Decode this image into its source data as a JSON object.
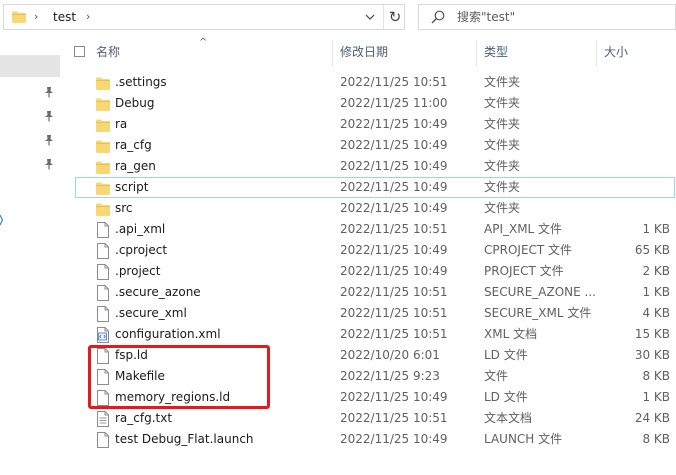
{
  "address_bar": {
    "path_segment": "test",
    "dropdown_glyph": "⌄",
    "refresh_glyph": "↻",
    "separator_glyph": "›"
  },
  "search": {
    "placeholder": "搜索\"test\""
  },
  "columns": {
    "name": "名称",
    "modified": "修改日期",
    "type": "类型",
    "size": "大小",
    "sort_glyph": "^"
  },
  "files": [
    {
      "name": ".settings",
      "date": "2022/11/25 10:51",
      "type": "文件夹",
      "size": "",
      "icon": "folder-icon"
    },
    {
      "name": "Debug",
      "date": "2022/11/25 11:00",
      "type": "文件夹",
      "size": "",
      "icon": "folder-icon"
    },
    {
      "name": "ra",
      "date": "2022/11/25 10:49",
      "type": "文件夹",
      "size": "",
      "icon": "folder-icon"
    },
    {
      "name": "ra_cfg",
      "date": "2022/11/25 10:49",
      "type": "文件夹",
      "size": "",
      "icon": "folder-icon"
    },
    {
      "name": "ra_gen",
      "date": "2022/11/25 10:49",
      "type": "文件夹",
      "size": "",
      "icon": "folder-icon"
    },
    {
      "name": "script",
      "date": "2022/11/25 10:49",
      "type": "文件夹",
      "size": "",
      "icon": "folder-icon"
    },
    {
      "name": "src",
      "date": "2022/11/25 10:49",
      "type": "文件夹",
      "size": "",
      "icon": "folder-icon"
    },
    {
      "name": ".api_xml",
      "date": "2022/11/25 10:51",
      "type": "API_XML 文件",
      "size": "1 KB",
      "icon": "file-icon"
    },
    {
      "name": ".cproject",
      "date": "2022/11/25 10:49",
      "type": "CPROJECT 文件",
      "size": "65 KB",
      "icon": "file-icon"
    },
    {
      "name": ".project",
      "date": "2022/11/25 10:49",
      "type": "PROJECT 文件",
      "size": "2 KB",
      "icon": "file-icon"
    },
    {
      "name": ".secure_azone",
      "date": "2022/11/25 10:51",
      "type": "SECURE_AZONE ...",
      "size": "1 KB",
      "icon": "file-icon"
    },
    {
      "name": ".secure_xml",
      "date": "2022/11/25 10:51",
      "type": "SECURE_XML 文件",
      "size": "4 KB",
      "icon": "file-icon"
    },
    {
      "name": "configuration.xml",
      "date": "2022/11/25 10:51",
      "type": "XML 文档",
      "size": "15 KB",
      "icon": "xml-file-icon"
    },
    {
      "name": "fsp.ld",
      "date": "2022/10/20 6:01",
      "type": "LD 文件",
      "size": "30 KB",
      "icon": "file-icon"
    },
    {
      "name": "Makefile",
      "date": "2022/11/25 9:23",
      "type": "文件",
      "size": "8 KB",
      "icon": "file-icon"
    },
    {
      "name": "memory_regions.ld",
      "date": "2022/11/25 10:49",
      "type": "LD 文件",
      "size": "1 KB",
      "icon": "file-icon"
    },
    {
      "name": "ra_cfg.txt",
      "date": "2022/11/25 10:51",
      "type": "文本文档",
      "size": "24 KB",
      "icon": "text-file-icon"
    },
    {
      "name": "test Debug_Flat.launch",
      "date": "2022/11/25 10:49",
      "type": "LAUNCH 文件",
      "size": "8 KB",
      "icon": "file-icon"
    }
  ],
  "focused_row": "script",
  "highlighted_files": [
    "fsp.ld",
    "Makefile",
    "memory_regions.ld"
  ],
  "colors": {
    "folder": "#f8d775",
    "folder_dark": "#e8b94a",
    "highlight": "#e8191b",
    "focus_border": "#99d1ff",
    "header_text": "#4c607a",
    "nav_selected": "#e5e5e5"
  }
}
